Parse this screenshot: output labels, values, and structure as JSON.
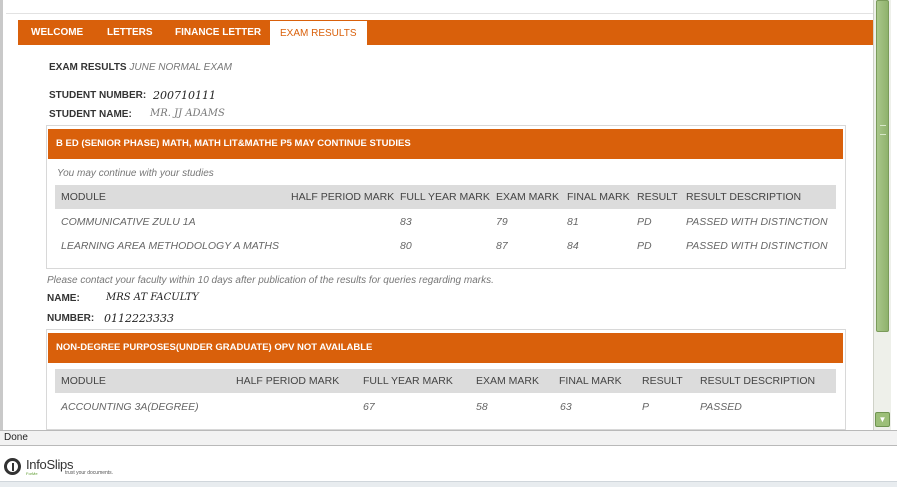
{
  "tabs": [
    {
      "label": "WELCOME",
      "active": false
    },
    {
      "label": "LETTERS",
      "active": false
    },
    {
      "label": "FINANCE LETTER",
      "active": false
    },
    {
      "label": "EXAM RESULTS",
      "active": true
    }
  ],
  "exam": {
    "heading_label": "EXAM RESULTS",
    "heading_value": "JUNE NORMAL EXAM",
    "student_number_label": "STUDENT NUMBER:",
    "student_number": "200710111",
    "student_name_label": "STUDENT NAME:",
    "student_name": "MR. JJ ADAMS"
  },
  "qualification_1": {
    "title": "B ED (SENIOR PHASE) MATH, MATH LIT&MATHE P5 MAY CONTINUE STUDIES",
    "note": "You may continue with your studies",
    "columns": [
      "MODULE",
      "HALF PERIOD MARK",
      "FULL YEAR MARK",
      "EXAM MARK",
      "FINAL MARK",
      "RESULT",
      "RESULT DESCRIPTION"
    ],
    "rows": [
      {
        "module": "COMMUNICATIVE ZULU 1A",
        "half_period": "",
        "full_year": "83",
        "exam": "79",
        "final": "81",
        "result": "PD",
        "description": "PASSED WITH DISTINCTION"
      },
      {
        "module": "LEARNING AREA METHODOLOGY A MATHS",
        "half_period": "",
        "full_year": "80",
        "exam": "87",
        "final": "84",
        "result": "PD",
        "description": "PASSED WITH DISTINCTION"
      }
    ]
  },
  "contact": {
    "note": "Please contact your faculty within 10 days after publication of the results for queries regarding marks.",
    "name_label": "NAME:",
    "name": "MRS AT FACULTY",
    "number_label": "NUMBER:",
    "number": "0112223333"
  },
  "qualification_2": {
    "title": "NON-DEGREE PURPOSES(UNDER GRADUATE) OPV  NOT AVAILABLE",
    "columns": [
      "MODULE",
      "HALF PERIOD MARK",
      "FULL YEAR MARK",
      "EXAM MARK",
      "FINAL MARK",
      "RESULT",
      "RESULT DESCRIPTION"
    ],
    "rows": [
      {
        "module": "ACCOUNTING 3A(DEGREE)",
        "half_period": "",
        "full_year": "67",
        "exam": "58",
        "final": "63",
        "result": "P",
        "description": "PASSED"
      }
    ]
  },
  "status_bar": {
    "text": "Done"
  },
  "footer": {
    "logo_name": "InfoSlips",
    "logo_sub": "ForMe",
    "tagline": "trust your documents."
  },
  "colors": {
    "accent": "#d9600b",
    "table_header": "#dcdcdc",
    "scroll_thumb": "#9cbf78"
  }
}
